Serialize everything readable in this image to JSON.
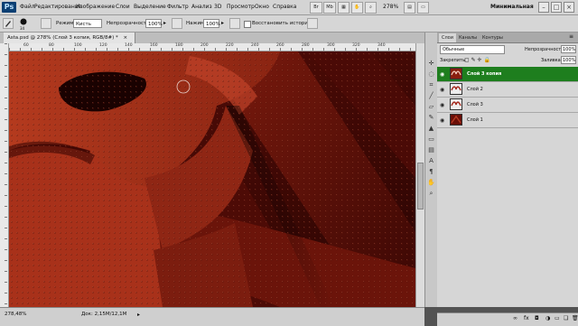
{
  "menubar": {
    "logo": "Ps",
    "items": [
      "Файл",
      "Редактирование",
      "Изображение",
      "Слои",
      "Выделение",
      "Фильтр",
      "Анализ",
      "3D",
      "Просмотр",
      "Окно",
      "Справка"
    ],
    "zoom": "278%",
    "workspace": "Минимальная"
  },
  "options": {
    "brush_size": "34",
    "mode_label": "Режим:",
    "mode_value": "Кисть",
    "opacity_label": "Непрозрачность:",
    "opacity_value": "100%",
    "pressure_label": "Нажим:",
    "pressure_value": "100%",
    "history_label": "Восстановить историю"
  },
  "document": {
    "tab_title": "Asta.psd @ 278% (Слой 3 копия, RGB/8#) *",
    "ruler_numbers": [
      "60",
      "80",
      "100",
      "120",
      "140",
      "160",
      "180",
      "200",
      "220",
      "240",
      "260",
      "280",
      "300",
      "320",
      "340"
    ]
  },
  "status": {
    "zoom": "278,48%",
    "doc": "Док: 2,15M/12,1M"
  },
  "layers_panel": {
    "tabs": [
      "Слои",
      "Каналы",
      "Контуры"
    ],
    "blend_mode": "Обычные",
    "opacity_label": "Непрозрачность:",
    "opacity_value": "100%",
    "lock_label": "Закрепить:",
    "fill_label": "Заливка:",
    "fill_value": "100%",
    "layers": [
      {
        "name": "Слой 3 копия",
        "selected": true
      },
      {
        "name": "Слой 2",
        "selected": false
      },
      {
        "name": "Слой 3",
        "selected": false
      },
      {
        "name": "Слой 1",
        "selected": false
      }
    ]
  },
  "colors": {
    "selected_layer": "#1e7e1e",
    "canvas_light": "#b8371f",
    "canvas_dark": "#3a0704"
  },
  "icons": [
    "eye-icon",
    "brush-icon",
    "move-tool-icon",
    "lasso-tool-icon",
    "crop-tool-icon",
    "eyedropper-icon",
    "healing-brush-icon",
    "brush-tool-icon",
    "stamp-tool-icon",
    "eraser-tool-icon",
    "gradient-tool-icon",
    "text-tool-icon",
    "pen-tool-icon",
    "hand-tool-icon",
    "zoom-tool-icon",
    "link-icon",
    "fx-icon",
    "mask-icon",
    "new-layer-icon",
    "trash-icon"
  ]
}
